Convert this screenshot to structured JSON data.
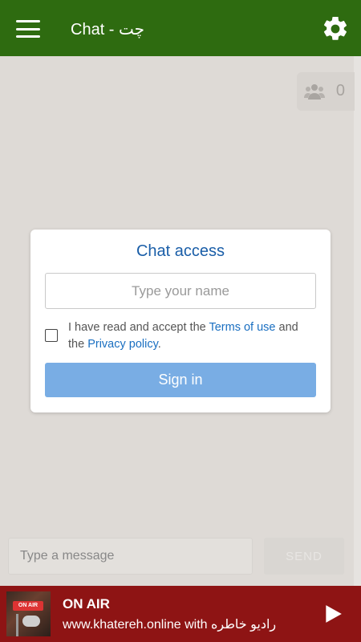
{
  "header": {
    "title": "Chat - چت",
    "menu_icon": "hamburger-menu-icon",
    "settings_icon": "gear-icon"
  },
  "users": {
    "icon": "users-group-icon",
    "count": "0"
  },
  "login": {
    "title": "Chat access",
    "name_placeholder": "Type your name",
    "terms_prefix": "I have read and accept the ",
    "terms_link": "Terms of use",
    "terms_middle": " and the ",
    "privacy_link": "Privacy policy",
    "terms_suffix": ".",
    "signin_label": "Sign in"
  },
  "composer": {
    "message_placeholder": "Type a message",
    "send_label": "SEND"
  },
  "player": {
    "status": "ON AIR",
    "track": "www.khatereh.online with رادیو خاطره",
    "play_icon": "play-icon"
  },
  "colors": {
    "header": "#2e6b10",
    "link": "#1a6fc1",
    "title": "#1a5ea8",
    "signin": "#79ade4",
    "player": "#8e1414"
  }
}
